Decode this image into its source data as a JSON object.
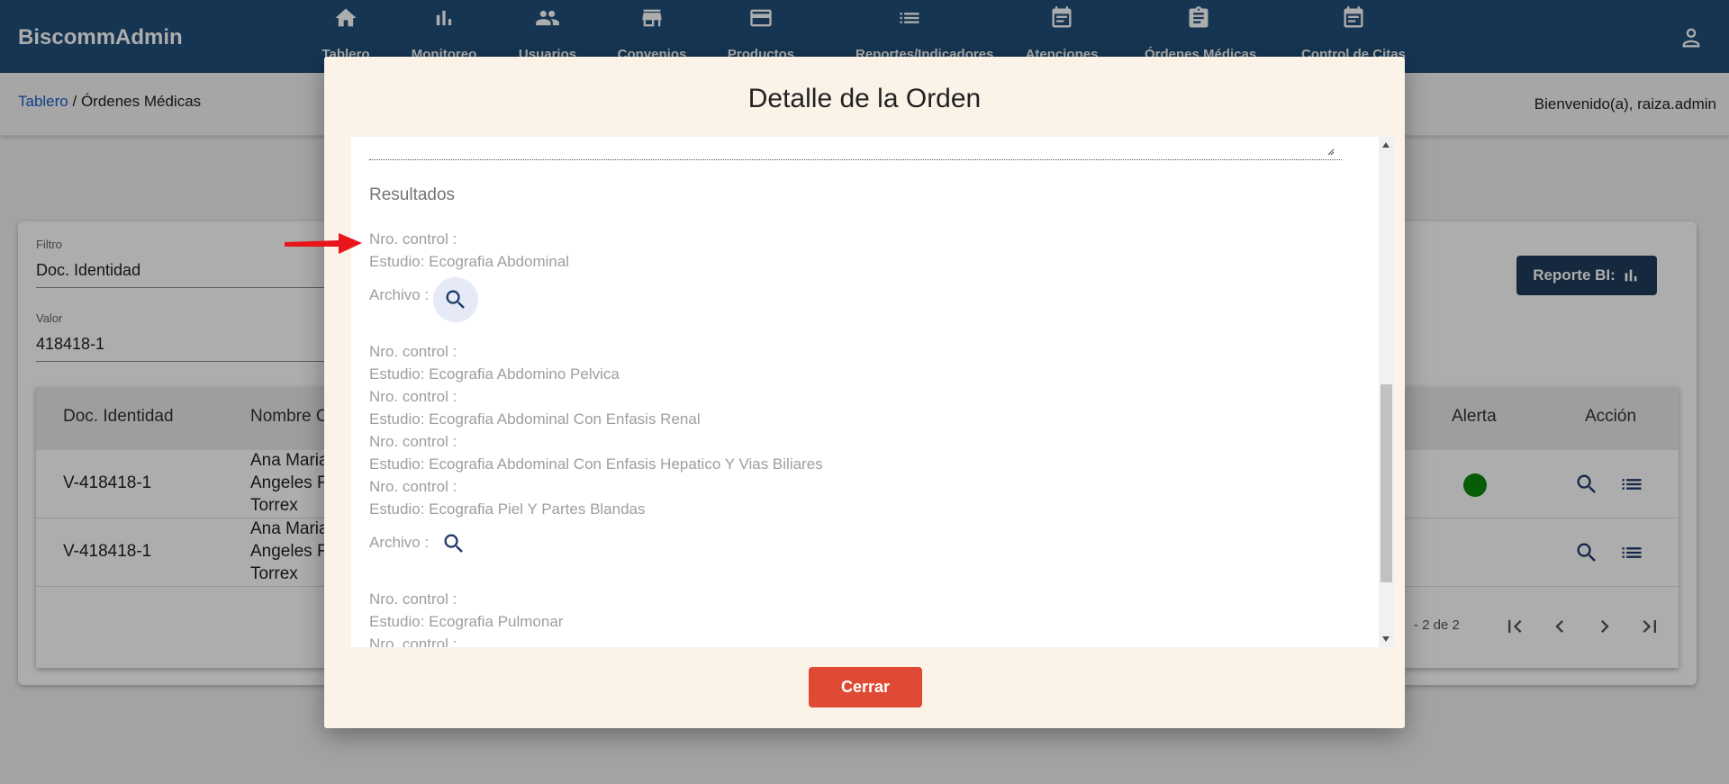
{
  "app": {
    "brand": "BiscommAdmin"
  },
  "nav": [
    {
      "label": "Tablero",
      "icon": "home-icon"
    },
    {
      "label": "Monitoreo",
      "icon": "bar-chart-icon"
    },
    {
      "label": "Usuarios",
      "icon": "people-icon"
    },
    {
      "label": "Convenios",
      "icon": "store-icon"
    },
    {
      "label": "Productos",
      "icon": "credit-card-icon"
    },
    {
      "label": "Reportes/Indicadores",
      "icon": "list-icon"
    },
    {
      "label": "Atenciones",
      "icon": "event-note-icon"
    },
    {
      "label": "Órdenes Médicas",
      "icon": "assignment-icon"
    },
    {
      "label": "Control de Citas",
      "icon": "event-note-icon"
    }
  ],
  "breadcrumb": {
    "home": "Tablero",
    "sep": " / ",
    "current": "Órdenes Médicas"
  },
  "welcome": "Bienvenido(a), raiza.admin",
  "filter": {
    "filtro_label": "Filtro",
    "filtro_value": "Doc. Identidad",
    "valor_label": "Valor",
    "valor_value": "418418-1"
  },
  "report_button": "Reporte BI:",
  "table": {
    "headers": {
      "doc": "Doc. Identidad",
      "nombre": "Nombre C",
      "alerta": "Alerta",
      "accion": "Acción"
    },
    "rows": [
      {
        "doc": "V-418418-1",
        "name1": "Ana Maria",
        "name2": "Angeles F",
        "name3": "Torrex",
        "alert": true
      },
      {
        "doc": "V-418418-1",
        "name1": "Ana Maria",
        "name2": "Angeles F",
        "name3": "Torrex",
        "alert": false
      }
    ],
    "pagination": "- 2 de 2"
  },
  "modal": {
    "title": "Detalle de la Orden",
    "results_title": "Resultados",
    "group1": {
      "control": "Nro. control :",
      "study": "Estudio: Ecografia Abdominal",
      "archivo": "Archivo :"
    },
    "group2": {
      "lines": [
        "Nro. control :",
        "Estudio: Ecografia Abdomino Pelvica",
        "Nro. control :",
        "Estudio: Ecografia Abdominal Con Enfasis Renal",
        "Nro. control :",
        "Estudio: Ecografia Abdominal Con Enfasis Hepatico Y Vias Biliares",
        "Nro. control :",
        "Estudio: Ecografia Piel Y Partes Blandas"
      ],
      "archivo": "Archivo :"
    },
    "group3": {
      "lines": [
        "Nro. control :",
        "Estudio: Ecografia Pulmonar",
        "Nro. control :"
      ]
    },
    "close_button": "Cerrar"
  },
  "colors": {
    "topbar": "#1f4e79",
    "close": "#e04a35",
    "alert": "#0a8a0a",
    "annotation_arrow": "#e8151b"
  }
}
